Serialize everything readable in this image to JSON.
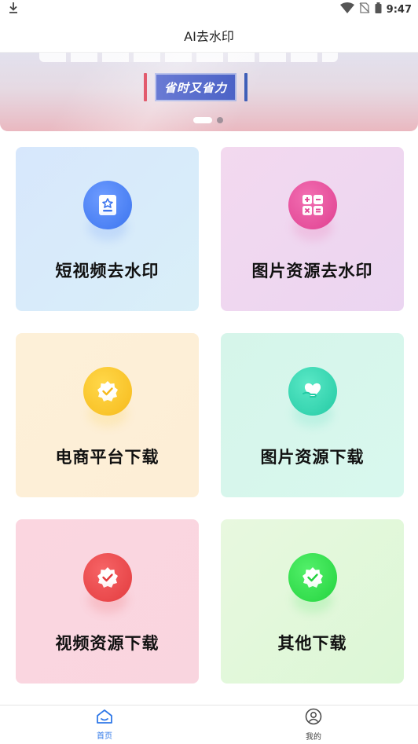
{
  "status_bar": {
    "time": "9:47",
    "icons": [
      "download-icon",
      "wifi-icon",
      "no-sim-icon",
      "battery-icon"
    ]
  },
  "header": {
    "title": "AI去水印"
  },
  "banner": {
    "badge_text": "省时又省力",
    "page_count": 2,
    "active_page": 1
  },
  "features": [
    {
      "label": "短视频去水印",
      "icon": "video-document-icon",
      "color": "#3a73ee"
    },
    {
      "label": "图片资源去水印",
      "icon": "calculator-icon",
      "color": "#df3e8f"
    },
    {
      "label": "电商平台下载",
      "icon": "badge-check-icon",
      "color": "#f6b91a"
    },
    {
      "label": "图片资源下载",
      "icon": "heart-hand-icon",
      "color": "#22c9a3"
    },
    {
      "label": "视频资源下载",
      "icon": "badge-check-icon",
      "color": "#e23a3d"
    },
    {
      "label": "其他下载",
      "icon": "badge-check-icon",
      "color": "#22d23d"
    }
  ],
  "bottom_nav": {
    "items": [
      {
        "label": "首页",
        "icon": "home-icon",
        "active": true,
        "color": "#2f78e8"
      },
      {
        "label": "我的",
        "icon": "user-profile-icon",
        "active": false,
        "color": "#444444"
      }
    ]
  }
}
